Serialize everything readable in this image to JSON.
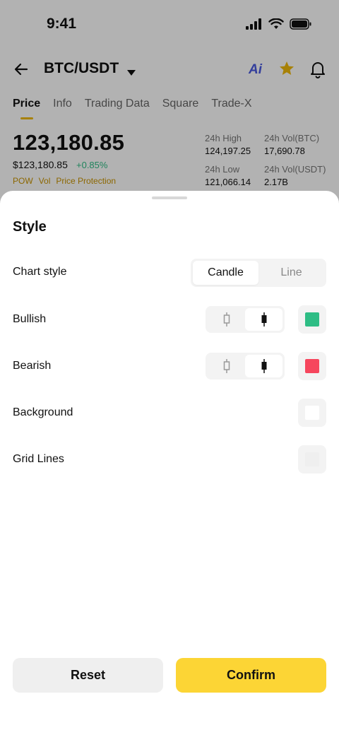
{
  "status_bar": {
    "time": "9:41"
  },
  "header": {
    "pair": "BTC/USDT",
    "ai_label": "Ai"
  },
  "tabs": [
    {
      "label": "Price",
      "active": true
    },
    {
      "label": "Info",
      "active": false
    },
    {
      "label": "Trading Data",
      "active": false
    },
    {
      "label": "Square",
      "active": false
    },
    {
      "label": "Trade-X",
      "active": false
    }
  ],
  "ticker": {
    "last_price": "123,180.85",
    "usd_price": "$123,180.85",
    "change": "+0.85%",
    "tags": [
      "POW",
      "Vol",
      "Price Protection"
    ],
    "stats": {
      "high_label": "24h High",
      "high_value": "124,197.25",
      "vol_btc_label": "24h Vol(BTC)",
      "vol_btc_value": "17,690.78",
      "low_label": "24h Low",
      "low_value": "121,066.14",
      "vol_usdt_label": "24h Vol(USDT)",
      "vol_usdt_value": "2.17B"
    }
  },
  "sheet": {
    "title": "Style",
    "chart_style": {
      "label": "Chart style",
      "options": [
        "Candle",
        "Line"
      ],
      "selected": "Candle"
    },
    "bullish": {
      "label": "Bullish",
      "color": "#2ebd85"
    },
    "bearish": {
      "label": "Bearish",
      "color": "#f6465d"
    },
    "background": {
      "label": "Background",
      "color": "#ffffff"
    },
    "grid_lines": {
      "label": "Grid Lines",
      "color": "#efefef"
    },
    "reset_label": "Reset",
    "confirm_label": "Confirm"
  },
  "colors": {
    "accent": "#fcd535",
    "up": "#2ebd85",
    "down": "#f6465d"
  }
}
